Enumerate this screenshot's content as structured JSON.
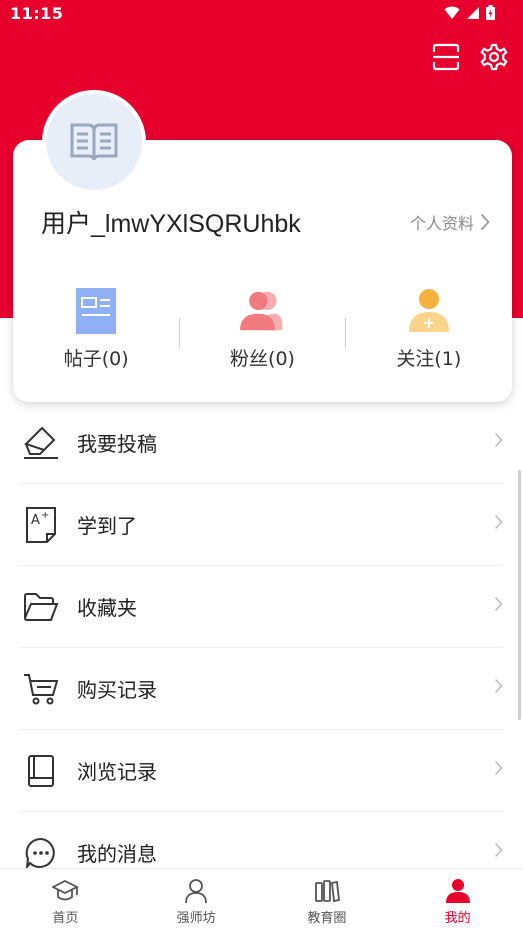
{
  "status_bar": {
    "time": "11:15"
  },
  "header": {
    "scan_icon": "scan-icon",
    "settings_icon": "gear-icon",
    "accent": "#e8002d"
  },
  "profile": {
    "username": "用户_lmwYXlSQRUhbk",
    "profile_link": "个人资料",
    "avatar_icon": "book-icon"
  },
  "stats": [
    {
      "label": "帖子(0)",
      "icon": "posts-icon"
    },
    {
      "label": "粉丝(0)",
      "icon": "fans-icon"
    },
    {
      "label": "关注(1)",
      "icon": "follow-icon"
    }
  ],
  "menu": [
    {
      "label": "我要投稿",
      "icon": "edit-icon"
    },
    {
      "label": "学到了",
      "icon": "learned-icon"
    },
    {
      "label": "收藏夹",
      "icon": "folder-icon"
    },
    {
      "label": "购买记录",
      "icon": "cart-icon"
    },
    {
      "label": "浏览记录",
      "icon": "book-history-icon"
    },
    {
      "label": "我的消息",
      "icon": "message-icon"
    }
  ],
  "tabs": [
    {
      "label": "首页",
      "icon": "graduation-cap-icon",
      "active": false
    },
    {
      "label": "强师坊",
      "icon": "person-icon",
      "active": false
    },
    {
      "label": "教育圈",
      "icon": "books-icon",
      "active": false
    },
    {
      "label": "我的",
      "icon": "profile-icon",
      "active": true
    }
  ]
}
